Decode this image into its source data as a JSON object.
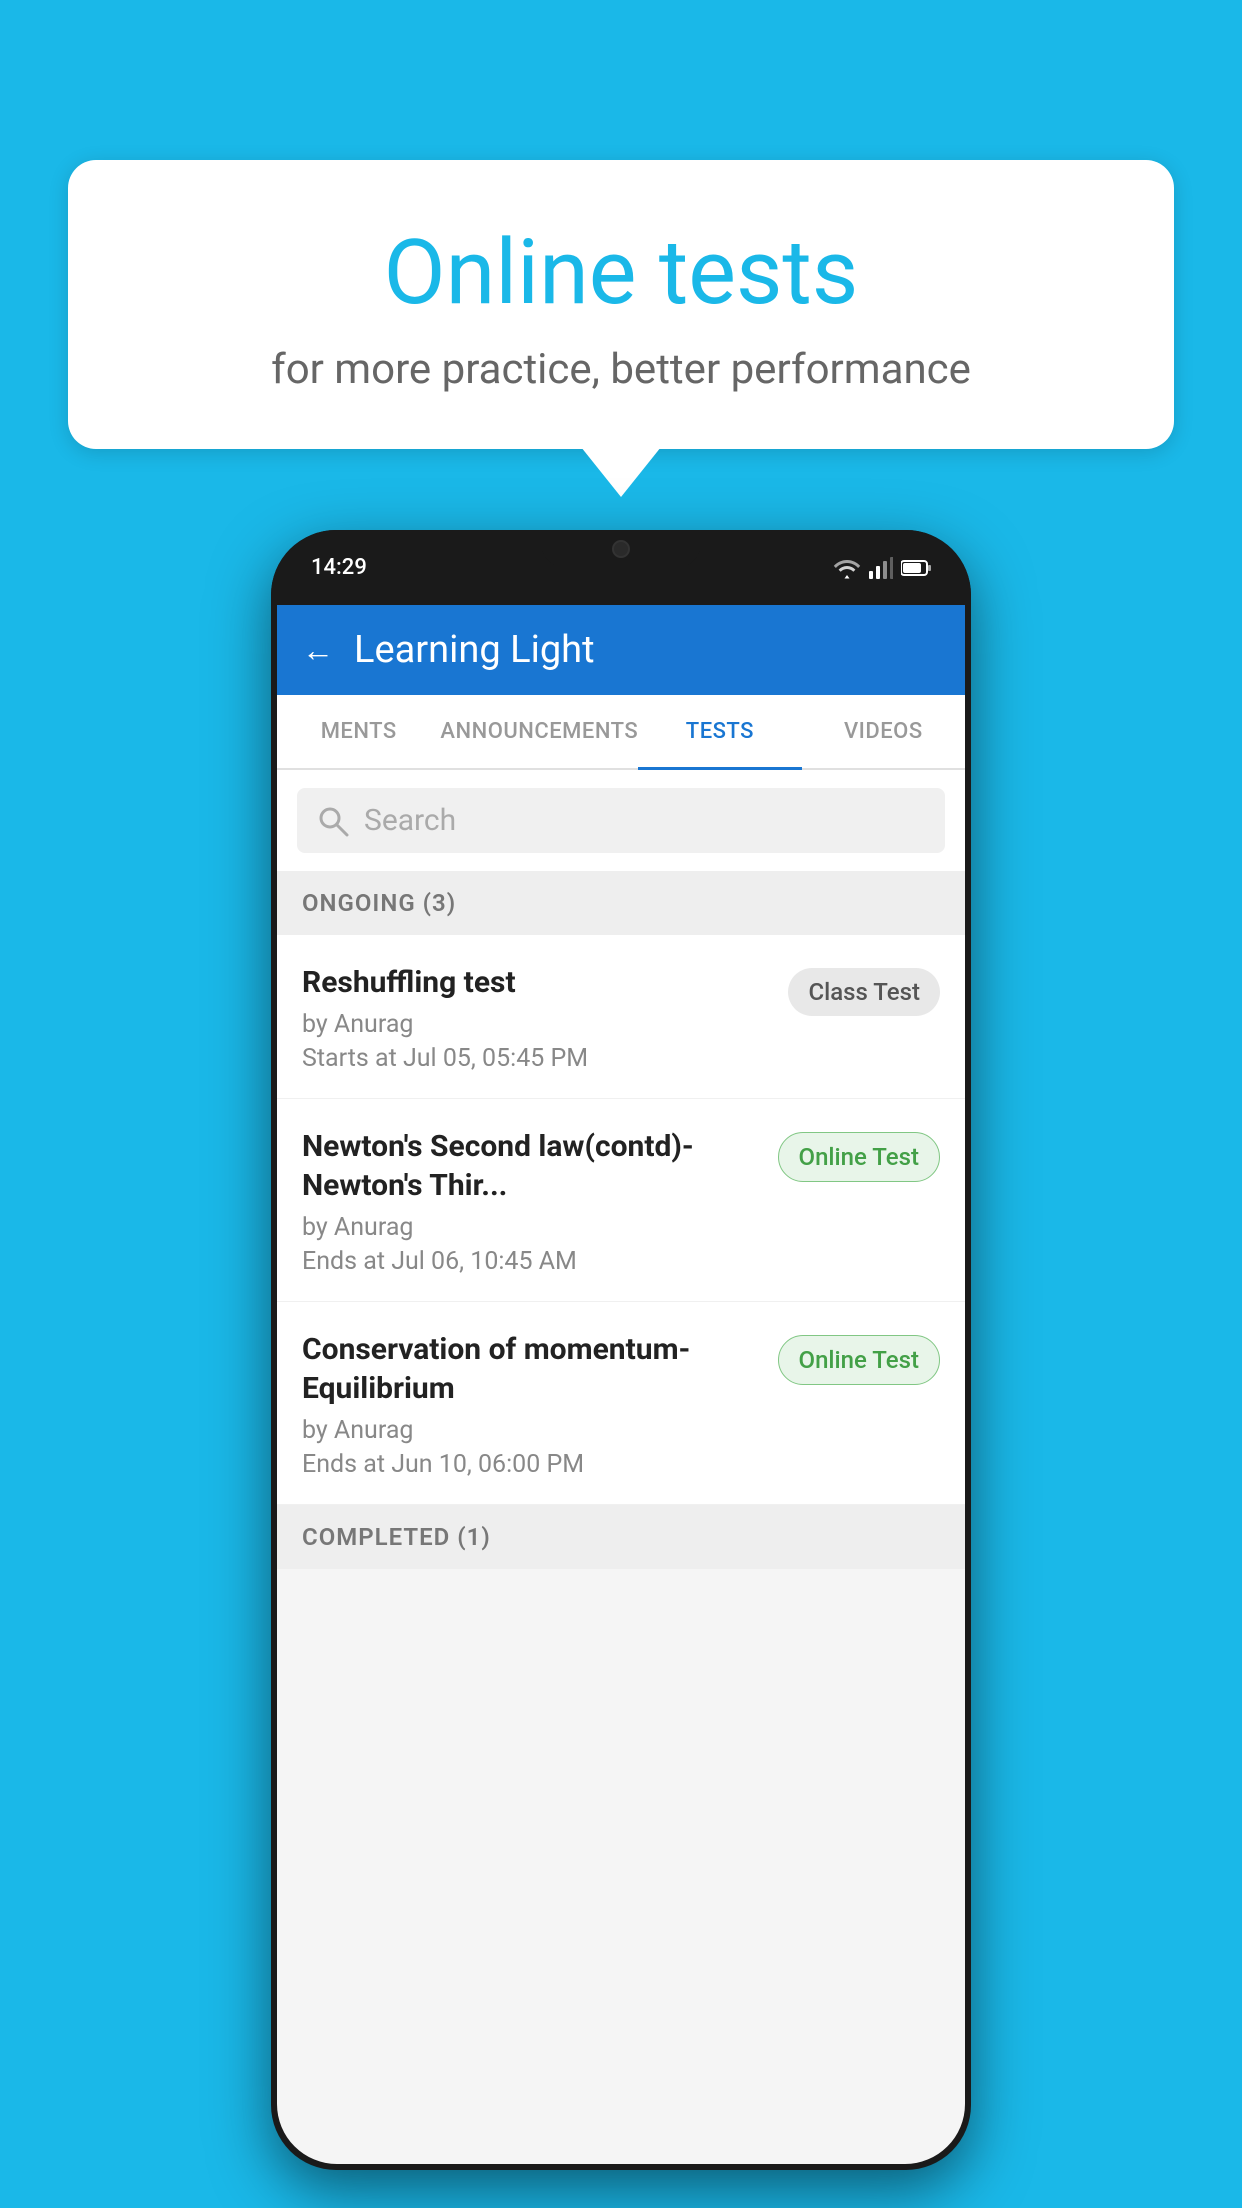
{
  "background_color": "#1ab8e8",
  "bubble": {
    "title": "Online tests",
    "subtitle": "for more practice, better performance"
  },
  "phone": {
    "status_time": "14:29",
    "status_icons": [
      "wifi",
      "signal",
      "battery"
    ]
  },
  "app": {
    "back_label": "←",
    "title": "Learning Light",
    "tabs": [
      {
        "id": "ments",
        "label": "MENTS",
        "active": false
      },
      {
        "id": "announcements",
        "label": "ANNOUNCEMENTS",
        "active": false
      },
      {
        "id": "tests",
        "label": "TESTS",
        "active": true
      },
      {
        "id": "videos",
        "label": "VIDEOS",
        "active": false
      }
    ],
    "search_placeholder": "Search",
    "ongoing_section": {
      "title": "ONGOING (3)",
      "tests": [
        {
          "name": "Reshuffling test",
          "author": "by Anurag",
          "date": "Starts at  Jul 05, 05:45 PM",
          "badge": "Class Test",
          "badge_type": "class"
        },
        {
          "name": "Newton's Second law(contd)-Newton's Thir...",
          "author": "by Anurag",
          "date": "Ends at  Jul 06, 10:45 AM",
          "badge": "Online Test",
          "badge_type": "online"
        },
        {
          "name": "Conservation of momentum-Equilibrium",
          "author": "by Anurag",
          "date": "Ends at  Jun 10, 06:00 PM",
          "badge": "Online Test",
          "badge_type": "online"
        }
      ]
    },
    "completed_section": {
      "title": "COMPLETED (1)"
    }
  }
}
